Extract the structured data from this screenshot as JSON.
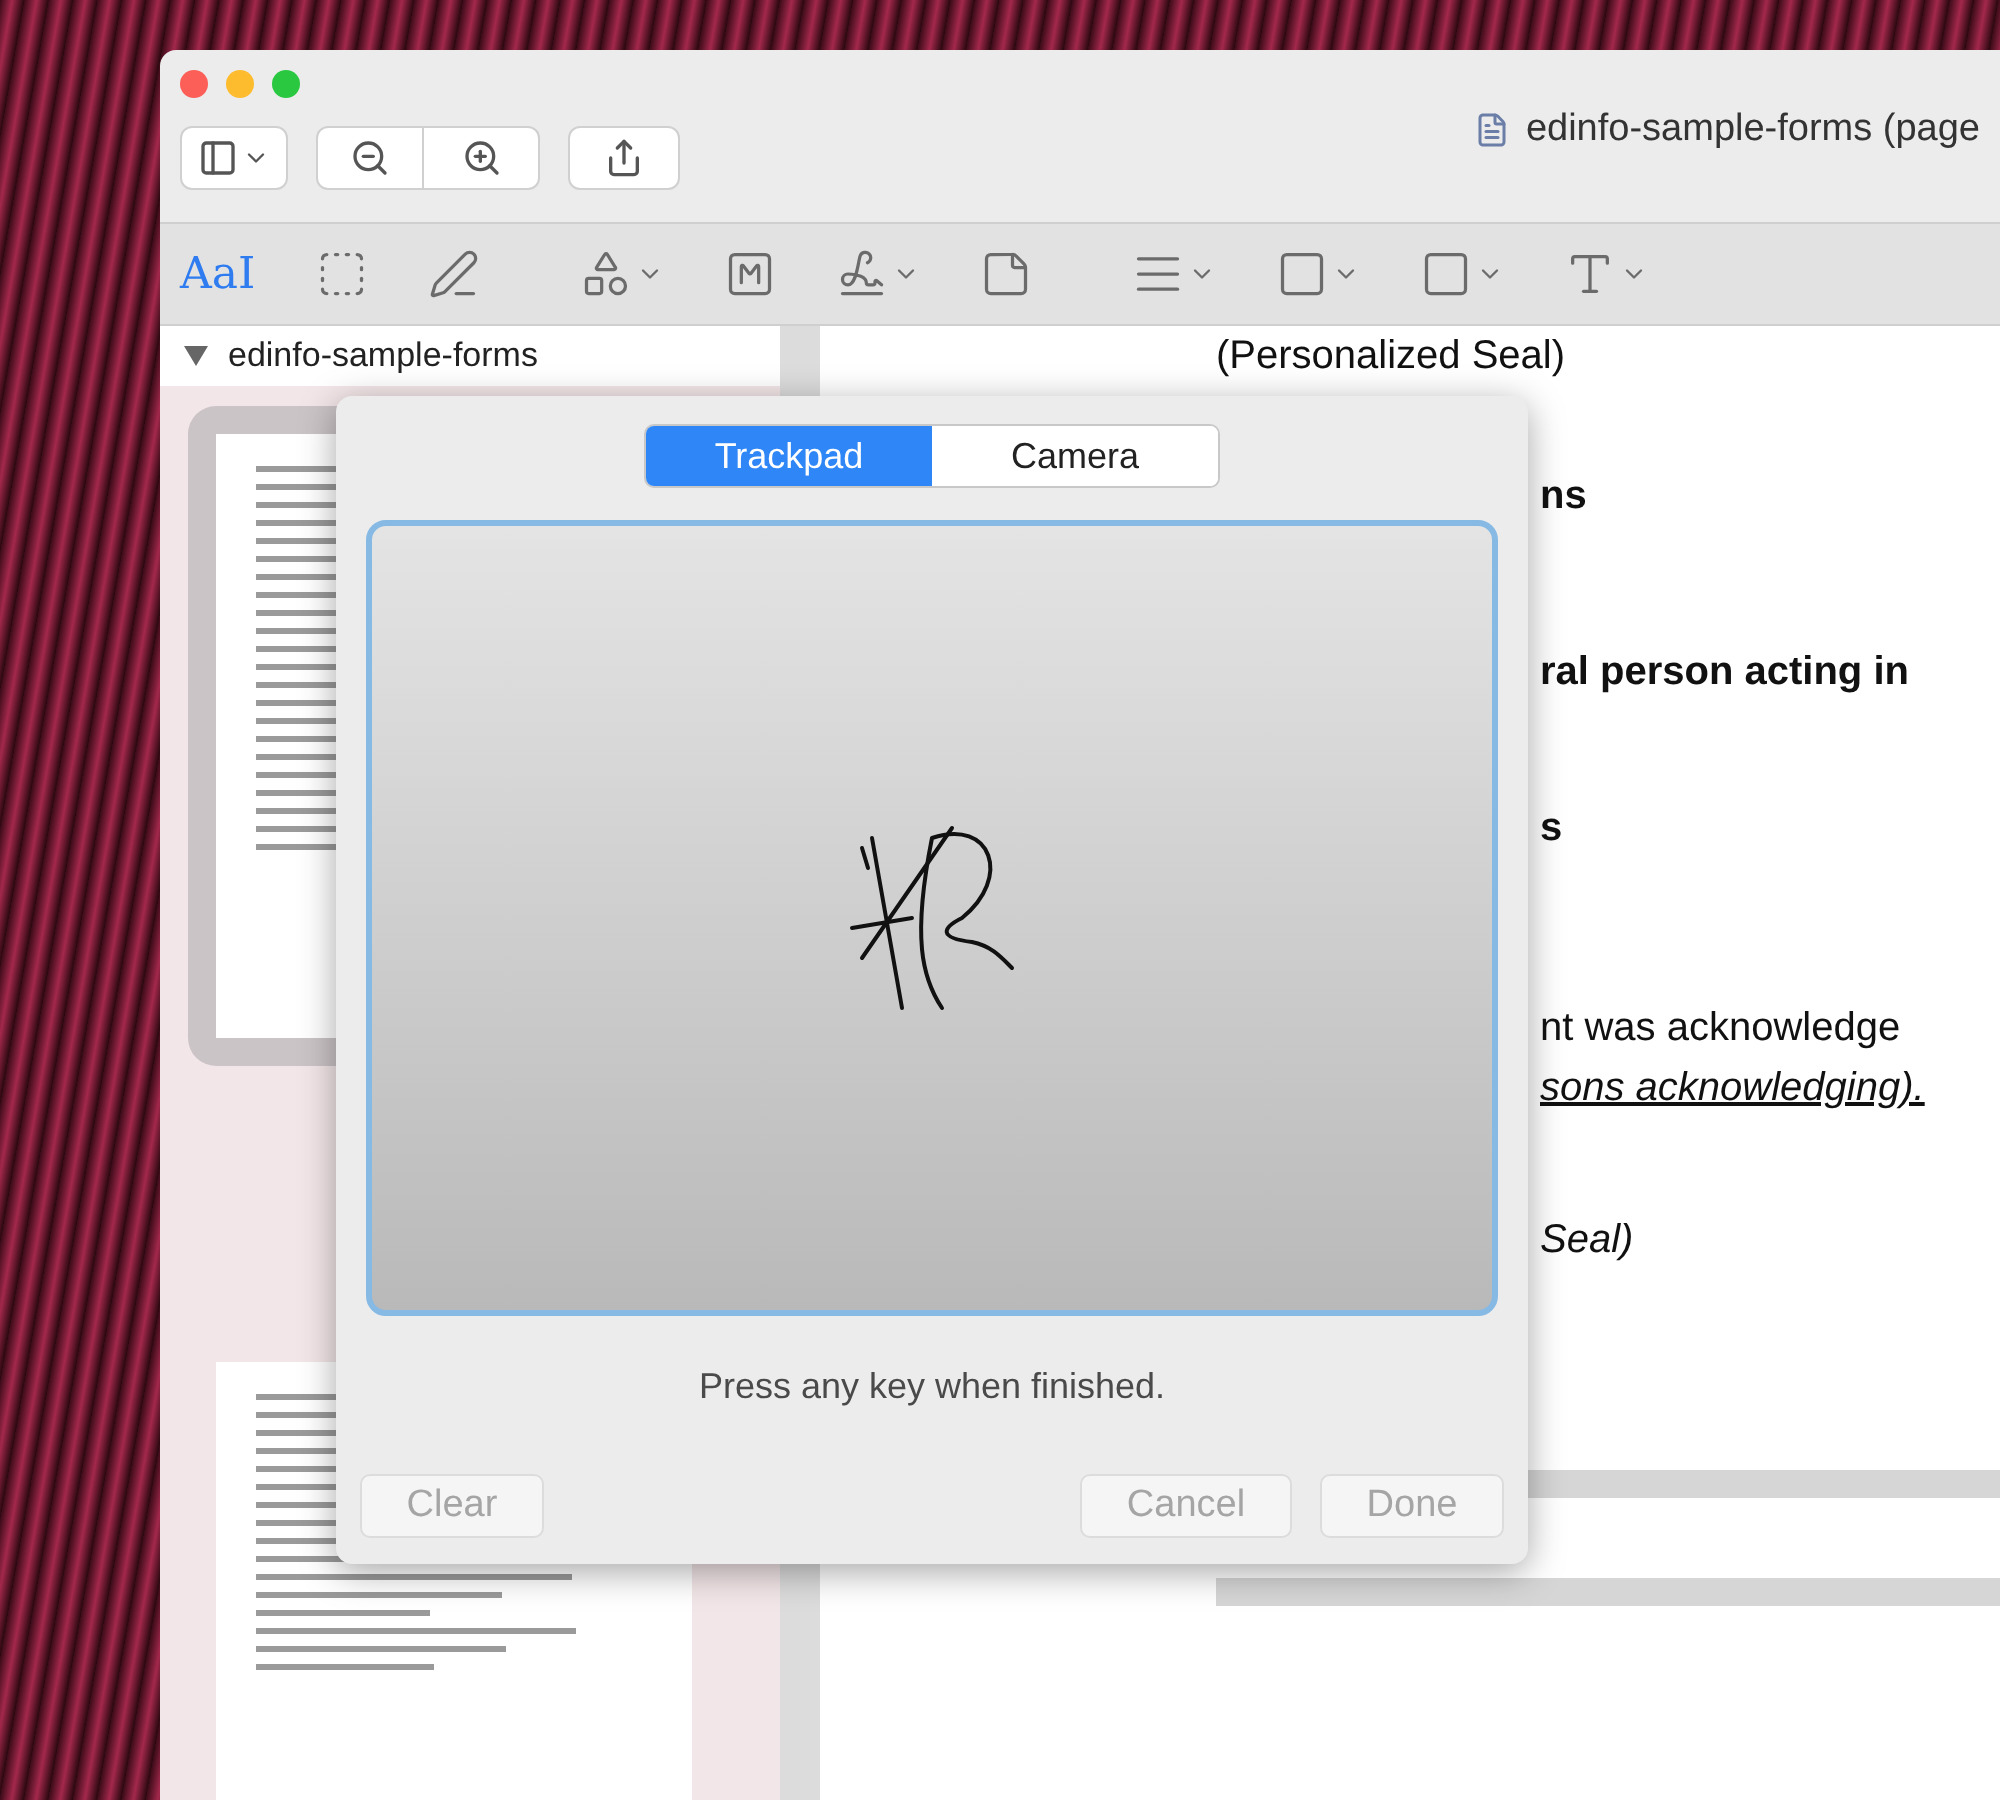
{
  "window": {
    "title": "edinfo-sample-forms (page"
  },
  "markup_tools": [
    {
      "kind": "text",
      "label": "AaI",
      "selected": true
    },
    {
      "kind": "select",
      "selected": false
    },
    {
      "kind": "sketch",
      "selected": false
    },
    {
      "kind": "shapes",
      "selected": false
    },
    {
      "kind": "textbox",
      "selected": false
    },
    {
      "kind": "sign",
      "selected": false
    },
    {
      "kind": "note",
      "selected": false
    },
    {
      "kind": "line",
      "selected": false
    },
    {
      "kind": "border",
      "selected": false
    },
    {
      "kind": "fill",
      "selected": false
    },
    {
      "kind": "font",
      "selected": false
    }
  ],
  "sidebar": {
    "document": "edinfo-sample-forms",
    "expanded": true
  },
  "document_lines": [
    {
      "text": "(Personalized Seal)",
      "kind": "plain"
    },
    {
      "text": "ns",
      "kind": "heading"
    },
    {
      "text": "ral person acting in",
      "kind": "heading"
    },
    {
      "text": "s",
      "kind": "heading"
    },
    {
      "text": "nt was acknowledge",
      "kind": "plain"
    },
    {
      "text": "sons acknowledging).",
      "kind": "blank"
    },
    {
      "text": "Seal)",
      "kind": "note"
    }
  ],
  "signature_panel": {
    "tabs": [
      {
        "label": "Trackpad",
        "selected": true
      },
      {
        "label": "Camera",
        "selected": false
      }
    ],
    "hint": "Press any key when finished.",
    "buttons": [
      {
        "label": "Clear",
        "disabled": true
      },
      {
        "label": "Cancel",
        "disabled": true
      },
      {
        "label": "Done",
        "disabled": true
      }
    ]
  }
}
